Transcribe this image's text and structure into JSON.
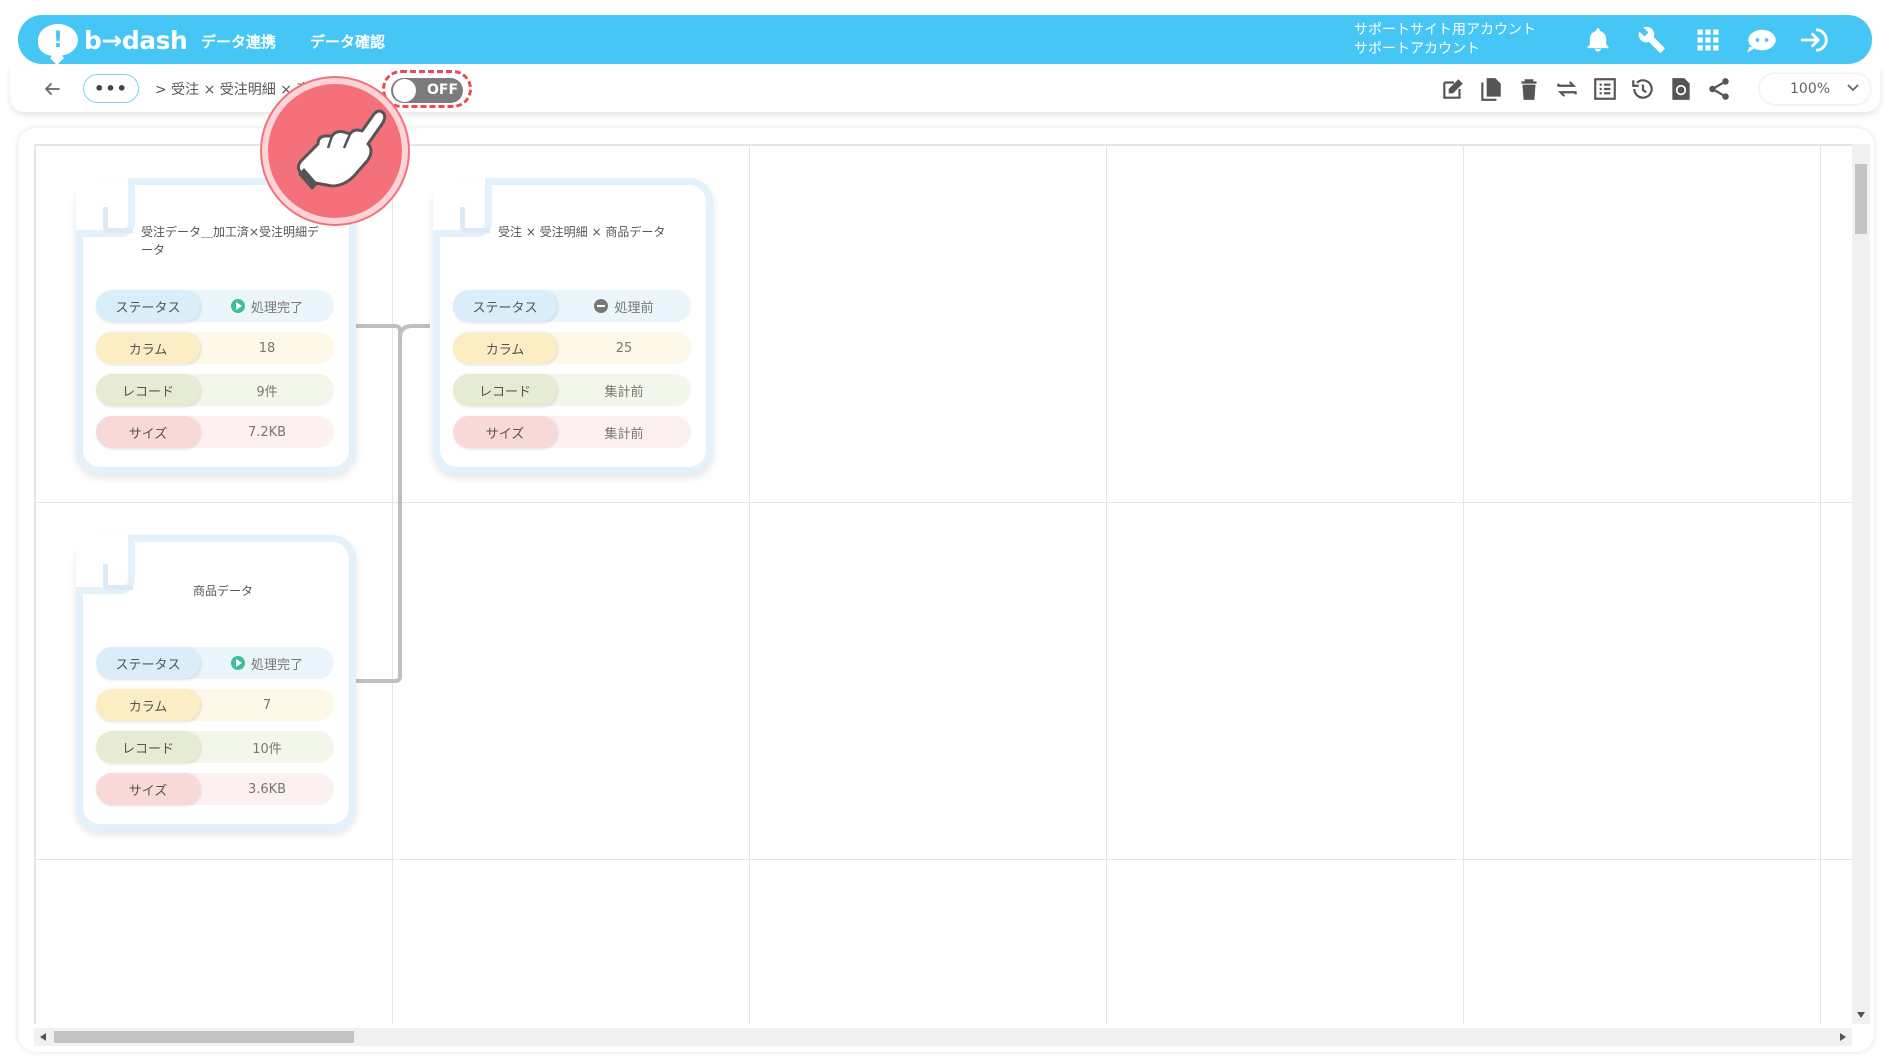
{
  "header": {
    "logo_text": "b→dash",
    "nav": [
      "データ連携",
      "データ確認"
    ],
    "account_line1": "サポートサイト用アカウント",
    "account_line2": "サポートアカウント",
    "icons": [
      "bell-icon",
      "wrench-icon",
      "grid-icon",
      "chatbot-icon",
      "logout-icon"
    ],
    "color": "#46c6f5"
  },
  "toolbar": {
    "more_label": "•••",
    "breadcrumb": "> 受注 × 受注明細 × 商",
    "toggle_label": "OFF",
    "zoom_value": "100%",
    "icons": [
      "edit-icon",
      "copy-icon",
      "delete-icon",
      "swap-icon",
      "list-icon",
      "history-icon",
      "refresh-icon",
      "share-icon"
    ]
  },
  "cards": [
    {
      "title": "受注データ＿加工済×受注明細データ",
      "status_label": "ステータス",
      "status_value": "処理完了",
      "column_label": "カラム",
      "column_value": "18",
      "record_label": "レコード",
      "record_value": "9件",
      "size_label": "サイズ",
      "size_value": "7.2KB"
    },
    {
      "title": "受注 × 受注明細 × 商品データ",
      "status_label": "ステータス",
      "status_value": "処理前",
      "column_label": "カラム",
      "column_value": "25",
      "record_label": "レコード",
      "record_value": "集計前",
      "size_label": "サイズ",
      "size_value": "集計前"
    },
    {
      "title": "商品データ",
      "status_label": "ステータス",
      "status_value": "処理完了",
      "column_label": "カラム",
      "column_value": "7",
      "record_label": "レコード",
      "record_value": "10件",
      "size_label": "サイズ",
      "size_value": "3.6KB"
    }
  ]
}
